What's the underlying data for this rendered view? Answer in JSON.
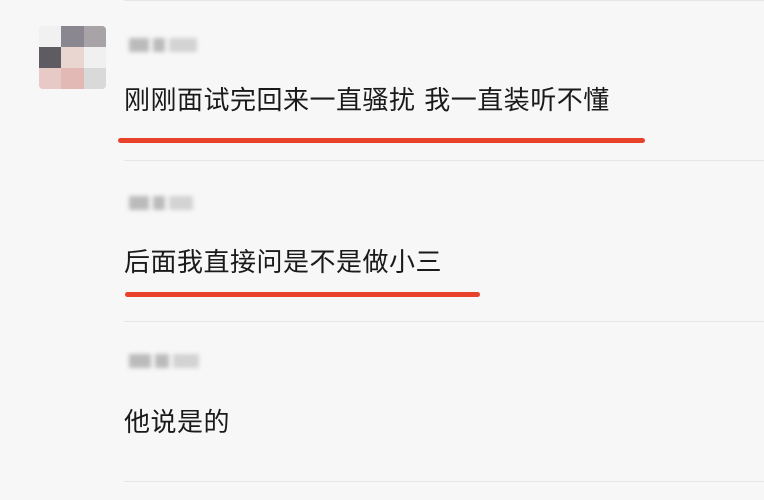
{
  "messages": [
    {
      "text": "刚刚面试完回来一直骚扰 我一直装听不懂"
    },
    {
      "text": "后面我直接问是不是做小三"
    },
    {
      "text": "他说是的"
    }
  ],
  "colors": {
    "background": "#f7f7f7",
    "highlight_underline": "#e8422b",
    "text": "#1a1a1a",
    "divider": "#e6e6e6"
  }
}
